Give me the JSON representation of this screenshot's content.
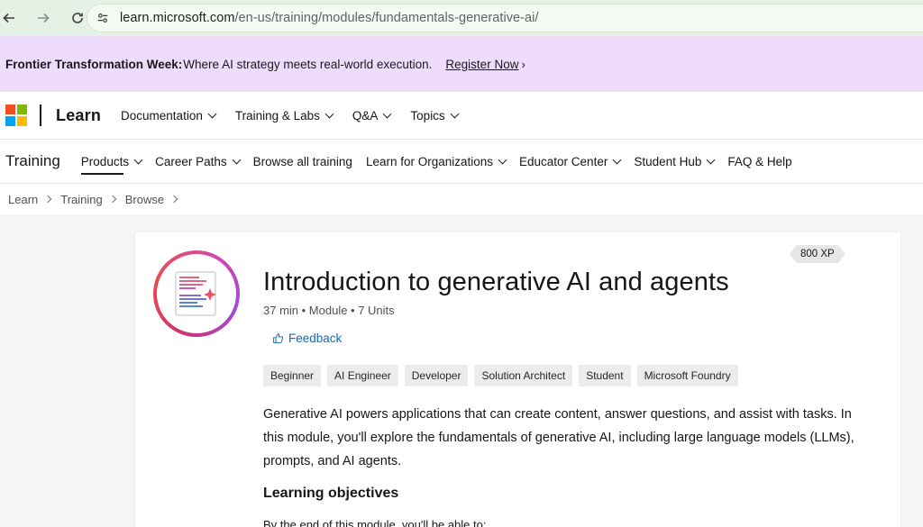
{
  "browser": {
    "url_domain": "learn.microsoft.com",
    "url_path": "/en-us/training/modules/fundamentals-generative-ai/"
  },
  "banner": {
    "bold": "Frontier Transformation Week:",
    "text": "Where AI strategy meets real-world execution.",
    "link": "Register Now"
  },
  "header": {
    "brand": "Learn",
    "nav": [
      "Documentation",
      "Training & Labs",
      "Q&A",
      "Topics"
    ]
  },
  "training_nav": {
    "title": "Training",
    "items": [
      "Products",
      "Career Paths",
      "Browse all training",
      "Learn for Organizations",
      "Educator Center",
      "Student Hub",
      "FAQ & Help"
    ]
  },
  "breadcrumb": [
    "Learn",
    "Training",
    "Browse"
  ],
  "module": {
    "xp": "800 XP",
    "title": "Introduction to generative AI and agents",
    "meta": "37 min • Module • 7 Units",
    "feedback": "Feedback",
    "tags": [
      "Beginner",
      "AI Engineer",
      "Developer",
      "Solution Architect",
      "Student",
      "Microsoft Foundry"
    ],
    "description": "Generative AI powers applications that can create content, answer questions, and assist with tasks. In this module, you'll explore the fundamentals of generative AI, including large language models (LLMs), prompts, and AI agents.",
    "objectives_heading": "Learning objectives",
    "objectives_intro": "By the end of this module, you'll be able to:"
  },
  "colors": {
    "banner_bg": "#efdbfb",
    "link_blue": "#0f6cbd",
    "chrome_bg": "#e6f1e6"
  }
}
